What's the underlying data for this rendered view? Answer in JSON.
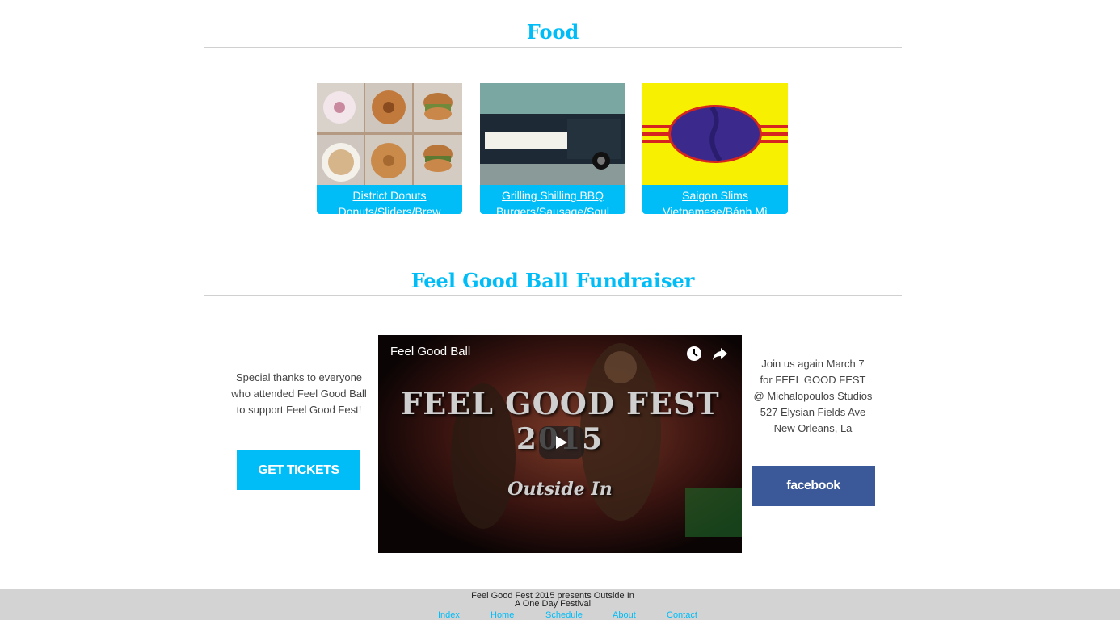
{
  "food": {
    "title": "Food",
    "vendors": [
      {
        "name": "District Donuts",
        "desc": "Donuts/Sliders/Brew"
      },
      {
        "name": "Grilling Shilling BBQ",
        "desc": "Burgers/Sausage/Soul"
      },
      {
        "name": "Saigon Slims",
        "desc": "Vietnamese/Bánh Mì"
      }
    ]
  },
  "fundraiser": {
    "title": "Feel Good Ball Fundraiser",
    "thanks_lines": [
      "Special thanks to everyone",
      "who attended Feel Good Ball",
      "to support Feel Good Fest!"
    ],
    "tickets_label": "GET TICKETS",
    "video": {
      "title": "Feel Good Ball",
      "frame_title": "FEEL GOOD FEST",
      "frame_year": "2015",
      "frame_subtitle": "Outside In"
    },
    "join_lines": [
      "Join us again March 7",
      "for FEEL GOOD FEST",
      "@ Michalopoulos Studios",
      "527 Elysian Fields Ave",
      "New Orleans, La"
    ],
    "facebook_label": "facebook"
  },
  "footer": {
    "line1": "Feel Good Fest 2015 presents Outside In",
    "line2": "A One Day Festival",
    "nav": [
      "Index",
      "Home",
      "Schedule",
      "About",
      "Contact"
    ]
  },
  "colors": {
    "accent": "#00bdf7",
    "facebook": "#3b5998",
    "footer_bg": "#d3d3d3"
  }
}
